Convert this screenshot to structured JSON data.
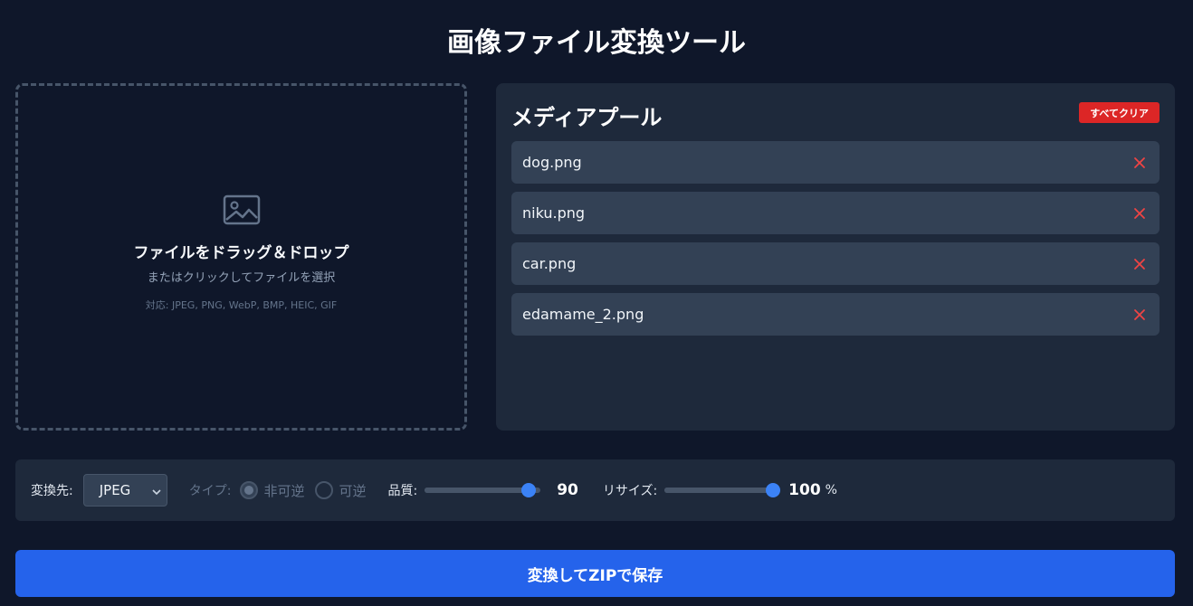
{
  "app": {
    "title": "画像ファイル変換ツール"
  },
  "dropzone": {
    "icon": "image-icon",
    "title": "ファイルをドラッグ＆ドロップ",
    "subtitle": "またはクリックしてファイルを選択",
    "formats": "対応: JPEG, PNG, WebP, BMP, HEIC, GIF"
  },
  "pool": {
    "title": "メディアプール",
    "clear_label": "すべてクリア",
    "files": [
      {
        "name": "dog.png"
      },
      {
        "name": "niku.png"
      },
      {
        "name": "car.png"
      },
      {
        "name": "edamame_2.png"
      }
    ]
  },
  "controls": {
    "format_label": "変換先:",
    "format_value": "JPEG",
    "type_label": "タイプ:",
    "type_options": [
      "非可逆",
      "可逆"
    ],
    "type_selected": "非可逆",
    "type_disabled": true,
    "quality_label": "品質:",
    "quality_value": "90",
    "quality_fraction": 0.9,
    "resize_label": "リサイズ:",
    "resize_value": "100",
    "resize_unit": "%",
    "resize_fraction": 1.0
  },
  "actions": {
    "convert_label": "変換してZIPで保存"
  },
  "colors": {
    "background": "#0f172a",
    "panel": "#1e293b",
    "item": "#334155",
    "accent": "#2563eb",
    "danger": "#dc2626",
    "slider_thumb": "#3b82f6"
  }
}
